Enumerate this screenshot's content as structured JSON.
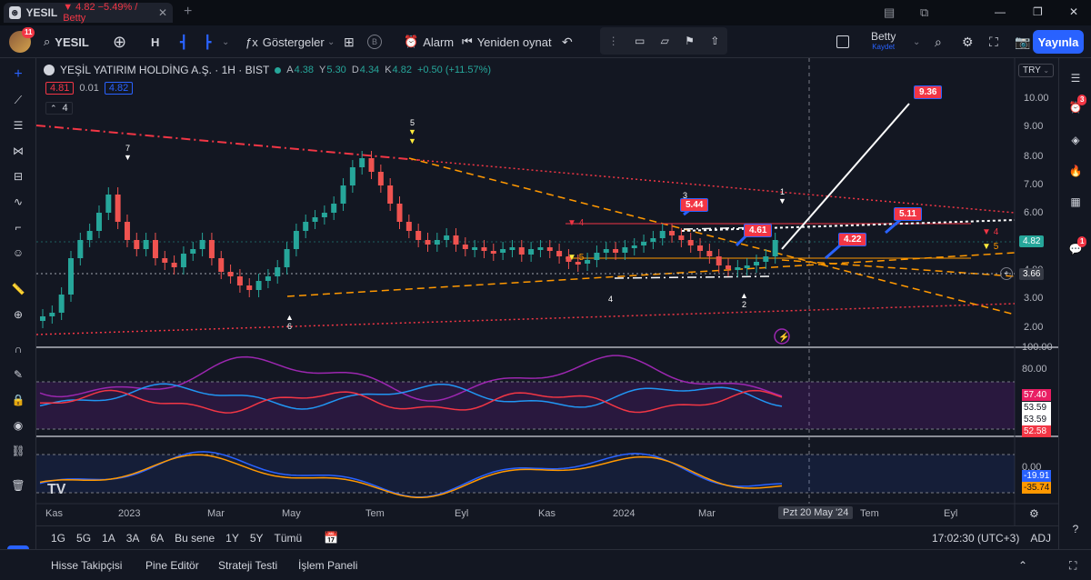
{
  "window": {
    "tab_title": "YESIL",
    "tab_change": "▼ 4.82 −5.49% / Betty",
    "minimize_icon": "—",
    "maximize_icon": "❐",
    "close_icon": "✕"
  },
  "toolbar": {
    "notifications": "11",
    "symbol": "YESIL",
    "interval": "H",
    "indicators_label": "Göstergeler",
    "alarm_label": "Alarm",
    "replay_label": "Yeniden oynat",
    "layout_name": "Betty",
    "layout_status": "Kaydet",
    "publish_label": "Yayınla"
  },
  "legend": {
    "title": "YEŞİL YATIRIM HOLDİNG A.Ş. · 1H · BIST",
    "o_label": "A",
    "o_value": "4.38",
    "h_label": "Y",
    "h_value": "5.30",
    "l_label": "D",
    "l_value": "4.34",
    "c_label": "K",
    "c_value": "4.82",
    "change": "+0.50 (+11.57%)",
    "bid": "4.81",
    "spread": "0.01",
    "ask": "4.82",
    "collapse_count": "4"
  },
  "price_axis": {
    "currency": "TRY",
    "ticks": [
      "10.00",
      "9.00",
      "8.00",
      "7.00",
      "6.00",
      "5.00",
      "4.00",
      "3.00",
      "2.00"
    ],
    "current_price": "4.82",
    "crosshair_price": "3.66"
  },
  "annotations": [
    {
      "label": "9.36"
    },
    {
      "label": "5.44"
    },
    {
      "label": "4.61"
    },
    {
      "label": "5.11"
    },
    {
      "label": "4.22"
    }
  ],
  "wave_labels": [
    "7",
    "5",
    "6",
    "3",
    "1",
    "4",
    "2",
    "4",
    "5",
    "4",
    "5"
  ],
  "indicator1": {
    "scale_top": "100.00",
    "scale_mid": "80.00",
    "values": [
      "57.40",
      "53.59",
      "53.59",
      "52.58"
    ],
    "colors": [
      "#e91e63",
      "#ffffff",
      "#ffffff",
      "#f23645"
    ]
  },
  "indicator2": {
    "values": [
      "0.00",
      "-19.91",
      "-35.74"
    ],
    "colors": [
      "#2962ff",
      "#2962ff",
      "#ff9800"
    ]
  },
  "time_axis": {
    "ticks": [
      "Kas",
      "2023",
      "Mar",
      "May",
      "Tem",
      "Eyl",
      "Kas",
      "2024",
      "Mar",
      "Tem",
      "Eyl"
    ],
    "crosshair_date": "Pzt 20 May '24"
  },
  "range_bar": {
    "ranges": [
      "1G",
      "5G",
      "1A",
      "3A",
      "6A",
      "Bu sene",
      "1Y",
      "5Y",
      "Tümü"
    ],
    "clock": "17:02:30 (UTC+3)",
    "adj": "ADJ"
  },
  "bottom_panel": {
    "tabs": [
      "Hisse Takipçisi",
      "Pine Editör",
      "Strateji Testi",
      "İşlem Paneli"
    ]
  },
  "right_badges": {
    "alerts": "3",
    "notifications": "1"
  },
  "logo_text": "TV"
}
